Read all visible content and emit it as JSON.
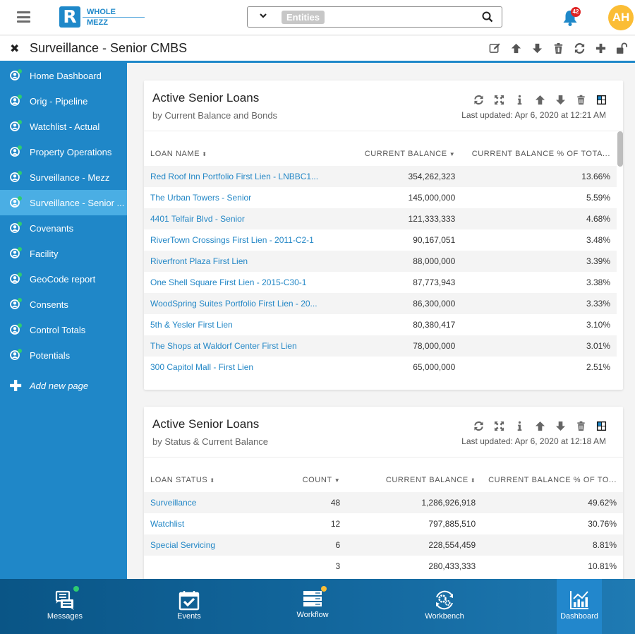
{
  "app": {
    "logo_letter": "R",
    "logo_line1": "WHOLE",
    "logo_line2": "MEZZ"
  },
  "search": {
    "chip": "Entities",
    "value": "",
    "dropdown_icon": "chevron-down-icon",
    "search_icon": "search-icon"
  },
  "notifications": {
    "count": "42",
    "color": "#1e88c9",
    "badge_color": "#e02424"
  },
  "user": {
    "initials": "AH",
    "color": "#fbbd35"
  },
  "page": {
    "title": "Surveillance - Senior CMBS",
    "close_glyph": "✖",
    "tools": [
      "edit-icon",
      "arrow-up-icon",
      "arrow-down-icon",
      "trash-icon",
      "refresh-icon",
      "plus-icon",
      "unlock-icon"
    ]
  },
  "sidebar": {
    "items": [
      {
        "label": "Home Dashboard",
        "active": false
      },
      {
        "label": "Orig - Pipeline",
        "active": false
      },
      {
        "label": "Watchlist - Actual",
        "active": false
      },
      {
        "label": "Property Operations",
        "active": false
      },
      {
        "label": "Surveillance - Mezz",
        "active": false
      },
      {
        "label": "Surveillance - Senior ...",
        "active": true
      },
      {
        "label": "Covenants",
        "active": false
      },
      {
        "label": "Facility",
        "active": false
      },
      {
        "label": "GeoCode report",
        "active": false
      },
      {
        "label": "Consents",
        "active": false
      },
      {
        "label": "Control Totals",
        "active": false
      },
      {
        "label": "Potentials",
        "active": false
      }
    ],
    "add_page_label": "Add new page"
  },
  "widgets": [
    {
      "title": "Active Senior Loans",
      "subtitle": "by Current Balance and Bonds",
      "updated": "Last updated: Apr 6, 2020 at 12:21 AM",
      "columns": [
        "LOAN NAME",
        "CURRENT BALANCE",
        "CURRENT BALANCE % OF TOTA..."
      ],
      "sort_indicators": [
        "⬍",
        "▼",
        ""
      ],
      "rows": [
        [
          "Red Roof Inn Portfolio First Lien - LNBBC1...",
          "354,262,323",
          "13.66%"
        ],
        [
          "The Urban Towers - Senior",
          "145,000,000",
          "5.59%"
        ],
        [
          "4401 Telfair Blvd - Senior",
          "121,333,333",
          "4.68%"
        ],
        [
          "RiverTown Crossings First Lien - 2011-C2-1",
          "90,167,051",
          "3.48%"
        ],
        [
          "Riverfront Plaza First Lien",
          "88,000,000",
          "3.39%"
        ],
        [
          "One Shell Square First Lien - 2015-C30-1",
          "87,773,943",
          "3.38%"
        ],
        [
          "WoodSpring Suites Portfolio First Lien - 20...",
          "86,300,000",
          "3.33%"
        ],
        [
          "5th & Yesler First Lien",
          "80,380,417",
          "3.10%"
        ],
        [
          "The Shops at Waldorf Center First Lien",
          "78,000,000",
          "3.01%"
        ],
        [
          "300 Capitol Mall - First Lien",
          "65,000,000",
          "2.51%"
        ]
      ]
    },
    {
      "title": "Active Senior Loans",
      "subtitle": "by Status & Current Balance",
      "updated": "Last updated: Apr 6, 2020 at 12:18 AM",
      "columns": [
        "LOAN STATUS",
        "COUNT",
        "CURRENT BALANCE",
        "CURRENT BALANCE % OF TO..."
      ],
      "sort_indicators": [
        "⬍",
        "▼",
        "⬍",
        ""
      ],
      "rows": [
        [
          "Surveillance",
          "48",
          "1,286,926,918",
          "49.62%"
        ],
        [
          "Watchlist",
          "12",
          "797,885,510",
          "30.76%"
        ],
        [
          "Special Servicing",
          "6",
          "228,554,459",
          "8.81%"
        ],
        [
          "",
          "3",
          "280,433,333",
          "10.81%"
        ]
      ]
    }
  ],
  "bottom_tabs": [
    {
      "label": "Messages",
      "icon": "messages-icon",
      "dot": "#2ecc71",
      "active": false
    },
    {
      "label": "Events",
      "icon": "calendar-check-icon",
      "dot": "",
      "active": false
    },
    {
      "label": "Workflow",
      "icon": "workflow-icon",
      "dot": "#fbbd35",
      "active": false
    },
    {
      "label": "Workbench",
      "icon": "workbench-gears-icon",
      "dot": "",
      "active": false
    },
    {
      "label": "Dashboard",
      "icon": "dashboard-chart-icon",
      "dot": "",
      "active": true
    }
  ]
}
